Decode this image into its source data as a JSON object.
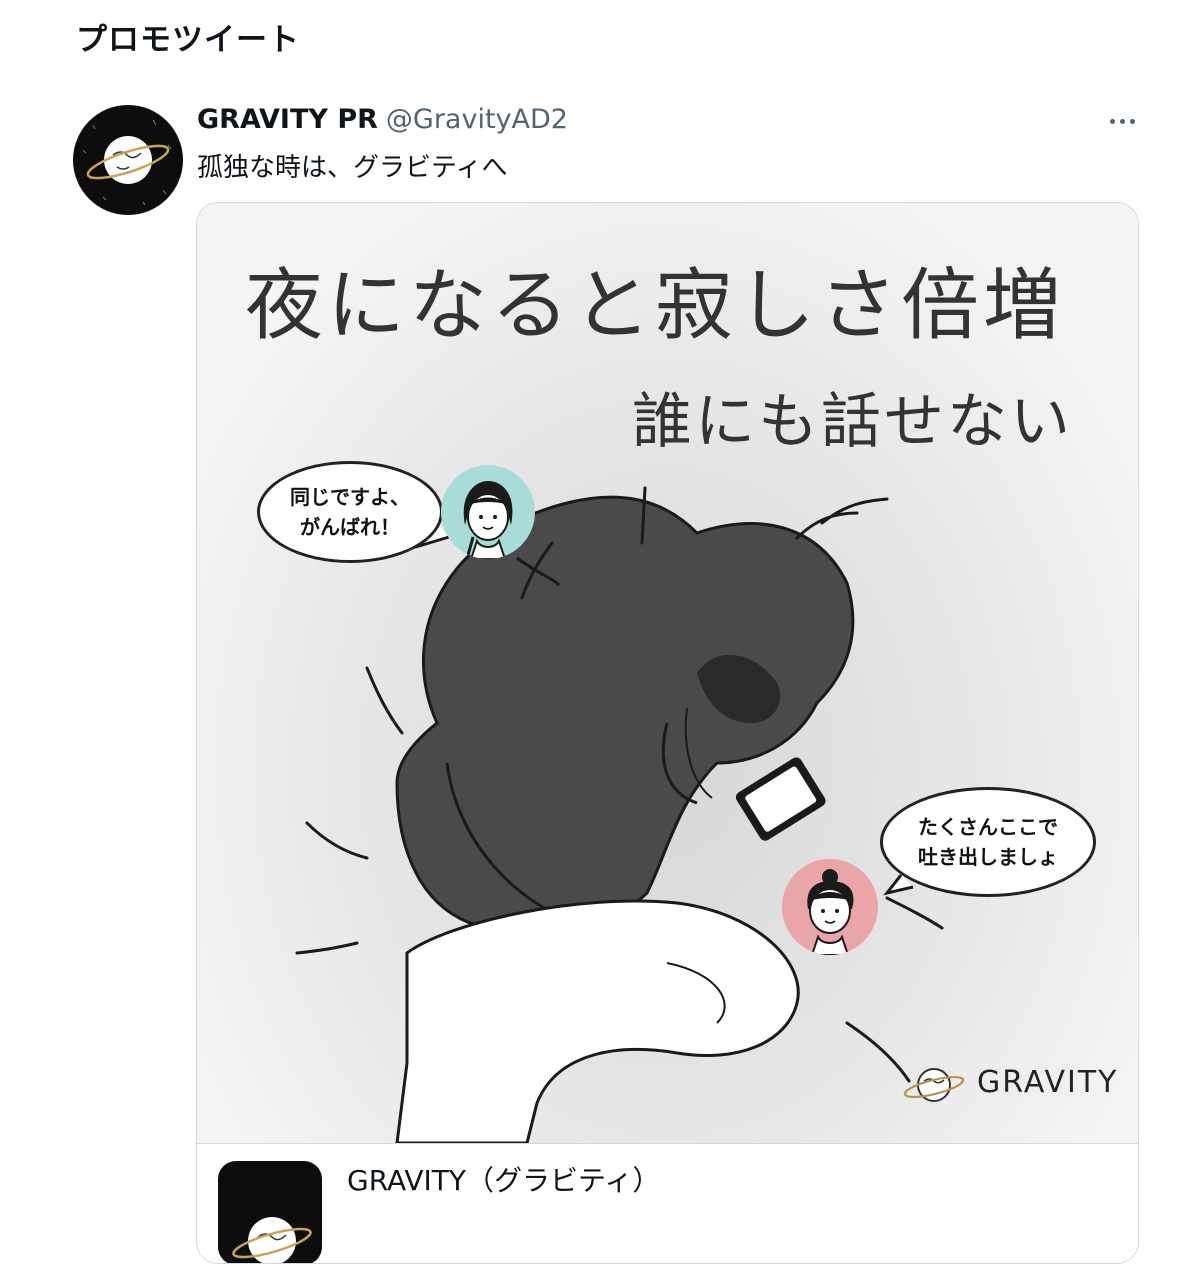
{
  "section": {
    "title": "プロモツイート"
  },
  "tweet": {
    "display_name": "GRAVITY PR",
    "handle": "@GravityAD2",
    "text": "孤独な時は、グラビティへ",
    "avatar_icon": "gravity-planet-logo-icon",
    "more_icon": "more-horizontal-icon"
  },
  "media": {
    "headline": "夜になると寂しさ倍増",
    "subline": "誰にも話せない",
    "bubble_left_line1": "同じですよ、",
    "bubble_left_line2": "がんばれ！",
    "bubble_right_line1": "たくさんここで",
    "bubble_right_line2": "吐き出しましょ",
    "brand_text": "GRAVITY"
  },
  "card": {
    "app_name": "GRAVITY（グラビティ）",
    "app_icon": "gravity-app-icon"
  },
  "colors": {
    "text": "#0f1419",
    "secondary": "#536471",
    "border": "#cfd9de",
    "teal_face_bg": "#a9dcd9",
    "pink_face_bg": "#eaa5a8"
  }
}
